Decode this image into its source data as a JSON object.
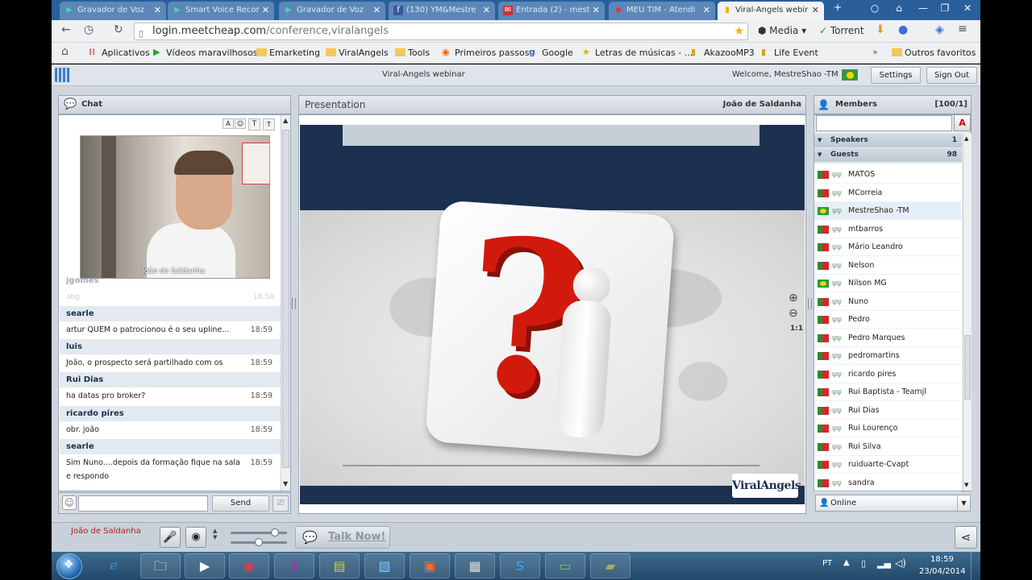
{
  "browser": {
    "tabs": [
      {
        "label": "Gravador de Voz",
        "icon": "play-icon"
      },
      {
        "label": "Smart Voice Recor",
        "icon": "play-icon"
      },
      {
        "label": "Gravador de Voz",
        "icon": "play-icon"
      },
      {
        "label": "(130) YM&Mestre",
        "icon": "facebook-icon"
      },
      {
        "label": "Entrada (2) - mest",
        "icon": "gmail-icon"
      },
      {
        "label": "MEU TIM - Atendi",
        "icon": "tim-icon"
      },
      {
        "label": "Viral-Angels webir",
        "icon": "page-icon",
        "active": true
      }
    ],
    "url_host": "login.meetcheap.com",
    "url_path": "/conference,viralangels",
    "ext_media": "Media",
    "ext_torrent": "Torrent",
    "bookmarks": [
      "Aplicativos",
      "Vídeos maravilhosos",
      "Emarketing",
      "ViralAngels",
      "Tools",
      "Primeiros passos",
      "Google",
      "Letras de músicas - ...",
      "AkazooMP3",
      "Life Event"
    ],
    "other_bookmarks": "Outros favoritos"
  },
  "app": {
    "title": "Viral-Angels webinar",
    "welcome": "Welcome, MestreShao -TM",
    "settings": "Settings",
    "signout": "Sign Out"
  },
  "chat": {
    "title": "Chat",
    "video_label": "João de Saldanha",
    "faded_name": "jgomes",
    "faded_msg": "obg",
    "faded_time": "18:58",
    "messages": [
      {
        "name": "searle",
        "text": "artur QUEM o patrocionou é o seu upline...",
        "time": "18:59"
      },
      {
        "name": "luis",
        "text": "João, o prospecto será partilhado com os sócios?",
        "time": "18:59"
      },
      {
        "name": "Rui Dias",
        "text": "ha datas pro broker?",
        "time": "18:59"
      },
      {
        "name": "ricardo pires",
        "text": "obr. joão",
        "time": "18:59"
      },
      {
        "name": "searle",
        "text": "Sim Nuno....depois da formação fique na sala e respondo",
        "time": "18:59"
      }
    ],
    "send": "Send"
  },
  "presentation": {
    "title": "Presentation",
    "presenter": "João de Saldanha",
    "zoom": "1:1",
    "logo": "ViralAngels"
  },
  "members": {
    "title": "Members",
    "count": "[100/1]",
    "speakers_label": "Speakers",
    "speakers_count": "1",
    "guests_label": "Guests",
    "guests_count": "98",
    "list": [
      {
        "name": "MATOS",
        "flag": "pt"
      },
      {
        "name": "MCorreia",
        "flag": "pt"
      },
      {
        "name": "MestreShao -TM",
        "flag": "br",
        "highlight": true
      },
      {
        "name": "mtbarros",
        "flag": "pt"
      },
      {
        "name": "Mário Leandro",
        "flag": "pt"
      },
      {
        "name": "Nelson",
        "flag": "pt"
      },
      {
        "name": "Nilson MG",
        "flag": "br"
      },
      {
        "name": "Nuno",
        "flag": "pt"
      },
      {
        "name": "Pedro",
        "flag": "pt"
      },
      {
        "name": "Pedro Marques",
        "flag": "pt"
      },
      {
        "name": "pedromartins",
        "flag": "pt"
      },
      {
        "name": "ricardo pires",
        "flag": "pt"
      },
      {
        "name": "Rui Baptista - Teamjl",
        "flag": "pt"
      },
      {
        "name": "Rui Dias",
        "flag": "pt"
      },
      {
        "name": "Rui Lourenço",
        "flag": "pt"
      },
      {
        "name": "Rui Silva",
        "flag": "pt"
      },
      {
        "name": "ruiduarte-Cvapt",
        "flag": "pt"
      },
      {
        "name": "sandra",
        "flag": "pt"
      }
    ],
    "status": "Online"
  },
  "bottom": {
    "presenter": "João de Saldanha",
    "talk": "Talk Now!"
  },
  "taskbar": {
    "lang": "PT",
    "time": "18:59",
    "date": "23/04/2014"
  }
}
